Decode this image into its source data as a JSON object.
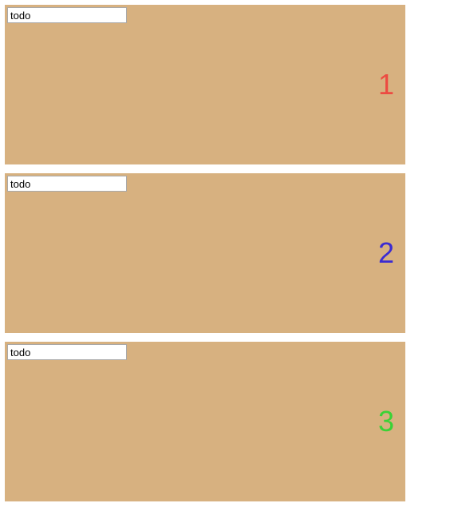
{
  "cards": [
    {
      "input_value": "todo",
      "number": "1",
      "color": "#ec4b42"
    },
    {
      "input_value": "todo",
      "number": "2",
      "color": "#3b2bd2"
    },
    {
      "input_value": "todo",
      "number": "3",
      "color": "#3ad235"
    }
  ]
}
